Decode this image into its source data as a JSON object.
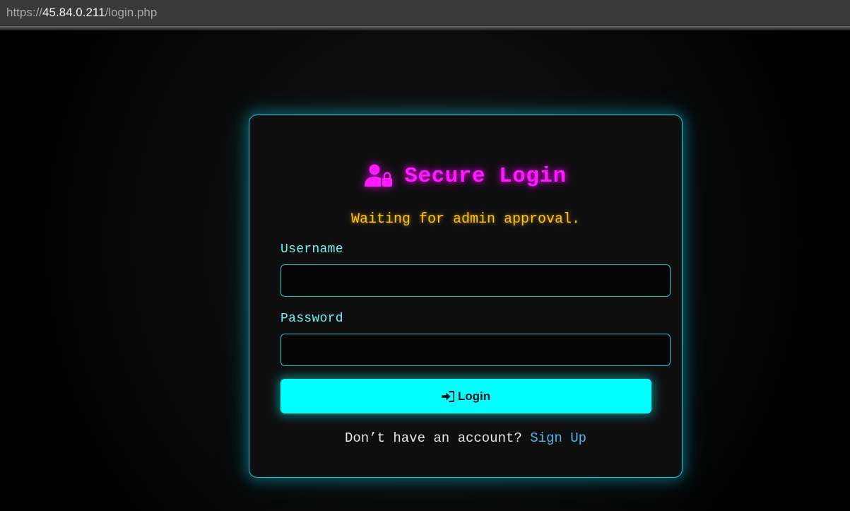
{
  "browser": {
    "url_scheme": "https://",
    "url_host": "45.84.0.211",
    "url_path": "/login.php"
  },
  "login_card": {
    "title": "Secure Login",
    "title_icon": "user-lock-icon",
    "status_message": "Waiting for admin approval.",
    "username_label": "Username",
    "username_value": "",
    "password_label": "Password",
    "password_value": "",
    "login_button_icon": "sign-in-icon",
    "login_button_label": "Login",
    "signup_prompt": "Don’t have an account?",
    "signup_link": "Sign Up"
  },
  "colors": {
    "title": "#ff1aff",
    "status": "#ffc316",
    "label": "#6ff2f2",
    "border": "#12c9d8",
    "button": "#00ffff",
    "link": "#4fb6f0",
    "background": "#000000"
  }
}
